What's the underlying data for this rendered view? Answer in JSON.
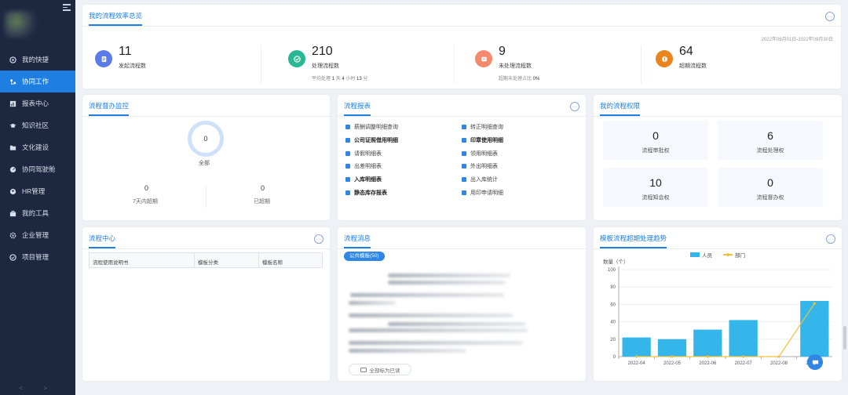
{
  "sidebar": {
    "items": [
      {
        "label": "我的快捷",
        "icon": "home-icon"
      },
      {
        "label": "协同工作",
        "icon": "collab-icon",
        "active": true
      },
      {
        "label": "报表中心",
        "icon": "report-icon"
      },
      {
        "label": "知识社区",
        "icon": "graduation-icon"
      },
      {
        "label": "文化建设",
        "icon": "folder-icon"
      },
      {
        "label": "协同驾驶舱",
        "icon": "cockpit-icon"
      },
      {
        "label": "HR管理",
        "icon": "hr-icon"
      },
      {
        "label": "我的工具",
        "icon": "toolbox-icon"
      },
      {
        "label": "企业管理",
        "icon": "gear-icon"
      },
      {
        "label": "项目管理",
        "icon": "project-icon"
      }
    ],
    "footer": "< >"
  },
  "overview": {
    "title": "我的流程效率总览",
    "date_range": "2022年09月01日-2022年09月30日",
    "stats": [
      {
        "value": "11",
        "label": "发起流程数",
        "color": "#5b7ce8",
        "icon": "document-icon"
      },
      {
        "value": "210",
        "label": "处理流程数",
        "color": "#28b894",
        "icon": "check-icon",
        "sub_prefix": "平均处理 ",
        "sub_d": "1",
        "sub_d_unit": " 天 ",
        "sub_h": "4",
        "sub_h_unit": " 小时 ",
        "sub_m": "13",
        "sub_m_unit": " 分"
      },
      {
        "value": "9",
        "label": "未处理流程数",
        "color": "#f4896f",
        "icon": "inbox-icon",
        "sub_prefix": "超期未处理占比 ",
        "sub_pct": "0%"
      },
      {
        "value": "64",
        "label": "超期流程数",
        "color": "#e9851f",
        "icon": "alert-icon"
      }
    ]
  },
  "monitor": {
    "title": "流程督办监控",
    "total_value": "0",
    "total_label": "全部",
    "left_value": "0",
    "left_label": "7天内超期",
    "right_value": "0",
    "right_label": "已超期"
  },
  "reports": {
    "title": "流程报表",
    "left": [
      {
        "label": "薪酬调整明细查询",
        "bold": false
      },
      {
        "label": "公司证照借用明细",
        "bold": true
      },
      {
        "label": "请假明细表",
        "bold": false
      },
      {
        "label": "出差明细表",
        "bold": false
      },
      {
        "label": "入库明细表",
        "bold": true
      },
      {
        "label": "静态库存报表",
        "bold": true
      }
    ],
    "right": [
      {
        "label": "转正明细查询",
        "bold": false
      },
      {
        "label": "印章使用明细",
        "bold": true
      },
      {
        "label": "领用明细表",
        "bold": false
      },
      {
        "label": "外出明细表",
        "bold": false
      },
      {
        "label": "出入库统计",
        "bold": false
      },
      {
        "label": "用印申请明细",
        "bold": false
      }
    ]
  },
  "permissions": {
    "title": "我的流程权限",
    "items": [
      {
        "value": "0",
        "label": "流程审批权"
      },
      {
        "value": "6",
        "label": "流程处理权"
      },
      {
        "value": "10",
        "label": "流程知会权"
      },
      {
        "value": "0",
        "label": "流程督办权"
      }
    ]
  },
  "center": {
    "title": "流程中心",
    "columns": [
      "流程使用说明书",
      "模板分类",
      "模板名称"
    ]
  },
  "messages": {
    "title": "流程消息",
    "pill": "公共模板(50)",
    "read_all": "全部标为已读"
  },
  "trend": {
    "title": "模板流程超期处理趋势",
    "y_unit_label": "数量（个）"
  },
  "chart_data": {
    "type": "bar",
    "title": "模板流程超期处理趋势",
    "ylabel": "数量（个）",
    "xlabel": "",
    "categories": [
      "2022-04",
      "2022-05",
      "2022-06",
      "2022-07",
      "2022-08",
      "2022-09"
    ],
    "series": [
      {
        "name": "人员",
        "type": "bar",
        "color": "#35b6ea",
        "values": [
          22,
          20,
          31,
          42,
          0,
          64
        ]
      },
      {
        "name": "部门",
        "type": "line",
        "color": "#f0c23b",
        "values": [
          0,
          0,
          0,
          0,
          0,
          61
        ]
      }
    ],
    "ylim": [
      0,
      100
    ],
    "yticks": [
      0,
      20,
      40,
      60,
      80,
      100
    ],
    "grid": true,
    "legend": "top-center"
  }
}
